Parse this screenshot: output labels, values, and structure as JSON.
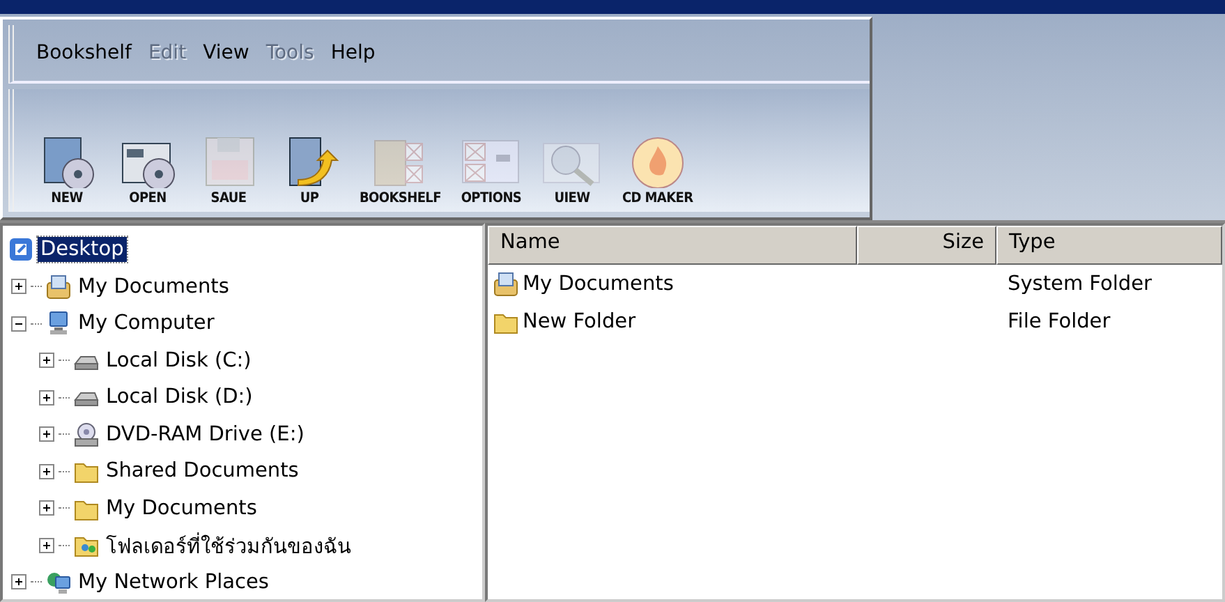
{
  "menu": [
    {
      "label": "Bookshelf",
      "disabled": false
    },
    {
      "label": "Edit",
      "disabled": true
    },
    {
      "label": "View",
      "disabled": false
    },
    {
      "label": "Tools",
      "disabled": true
    },
    {
      "label": "Help",
      "disabled": false
    }
  ],
  "toolbar": [
    {
      "kind": "new",
      "label": "NEW",
      "disabled": false
    },
    {
      "kind": "open",
      "label": "OPEN",
      "disabled": false
    },
    {
      "kind": "save",
      "label": "SAUE",
      "disabled": true
    },
    {
      "kind": "up",
      "label": "UP",
      "disabled": false
    },
    {
      "kind": "bookshelf",
      "label": "BOOKSHELF",
      "disabled": true
    },
    {
      "kind": "options",
      "label": "OPTIONS",
      "disabled": true
    },
    {
      "kind": "view",
      "label": "UIEW",
      "disabled": true
    },
    {
      "kind": "cd",
      "label": "CD MAKER",
      "disabled": false
    }
  ],
  "tree": [
    {
      "kind": "desktop",
      "label": "Desktop",
      "selected": true,
      "expanded": true,
      "children": [
        {
          "kind": "documents",
          "label": "My Documents",
          "selected": false,
          "expanded": false
        },
        {
          "kind": "computer",
          "label": "My Computer",
          "selected": false,
          "expanded": true,
          "children": [
            {
              "kind": "disk",
              "label": "Local Disk (C:)",
              "selected": false,
              "expanded": false
            },
            {
              "kind": "disk",
              "label": "Local Disk (D:)",
              "selected": false,
              "expanded": false
            },
            {
              "kind": "dvd",
              "label": "DVD-RAM Drive (E:)",
              "selected": false,
              "expanded": false
            },
            {
              "kind": "folder",
              "label": "Shared Documents",
              "selected": false,
              "expanded": false
            },
            {
              "kind": "folder",
              "label": "My Documents",
              "selected": false,
              "expanded": false
            },
            {
              "kind": "shared",
              "label": "โฟลเดอร์ที่ใช้ร่วมกันของฉัน",
              "selected": false,
              "expanded": false
            }
          ]
        },
        {
          "kind": "network",
          "label": "My Network Places",
          "selected": false,
          "expanded": false
        }
      ]
    }
  ],
  "list": {
    "columns": [
      "Name",
      "Size",
      "Type"
    ],
    "rows": [
      {
        "kind": "documents",
        "name": "My Documents",
        "type": "System Folder"
      },
      {
        "kind": "folder",
        "name": "New Folder",
        "type": "File Folder"
      }
    ]
  }
}
